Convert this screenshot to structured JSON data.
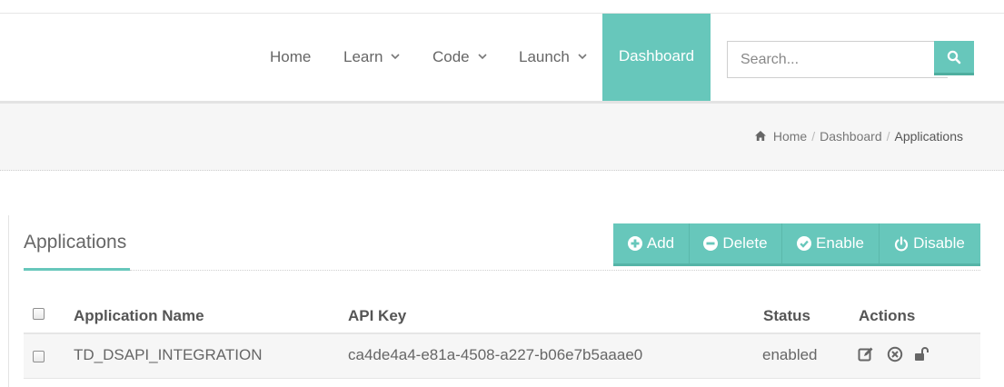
{
  "nav": {
    "items": [
      {
        "label": "Home",
        "dropdown": false
      },
      {
        "label": "Learn",
        "dropdown": true
      },
      {
        "label": "Code",
        "dropdown": true
      },
      {
        "label": "Launch",
        "dropdown": true
      },
      {
        "label": "Dashboard",
        "dropdown": false,
        "active": true
      }
    ],
    "search": {
      "placeholder": "Search...",
      "value": "",
      "button_icon": "search-icon"
    }
  },
  "breadcrumb": {
    "home_icon": "home-icon",
    "items": [
      "Home",
      "Dashboard",
      "Applications"
    ],
    "separator": "/"
  },
  "section": {
    "title": "Applications",
    "toolbar": {
      "add": {
        "label": "Add",
        "icon": "plus-circle-icon"
      },
      "delete": {
        "label": "Delete",
        "icon": "minus-circle-icon"
      },
      "enable": {
        "label": "Enable",
        "icon": "check-circle-icon"
      },
      "disable": {
        "label": "Disable",
        "icon": "power-icon"
      }
    }
  },
  "table": {
    "columns": [
      "Application Name",
      "API Key",
      "Status",
      "Actions"
    ],
    "rows": [
      {
        "name": "TD_DSAPI_INTEGRATION",
        "api_key": "ca4de4a4-e81a-4508-a227-b06e7b5aaae0",
        "status": "enabled",
        "actions": [
          "edit-icon",
          "remove-circle-icon",
          "unlock-icon"
        ],
        "checked": false
      }
    ]
  },
  "colors": {
    "accent": "#67c7bb",
    "accent_dark": "#55b4a7",
    "band": "#f6f6f6",
    "text": "#555555"
  }
}
